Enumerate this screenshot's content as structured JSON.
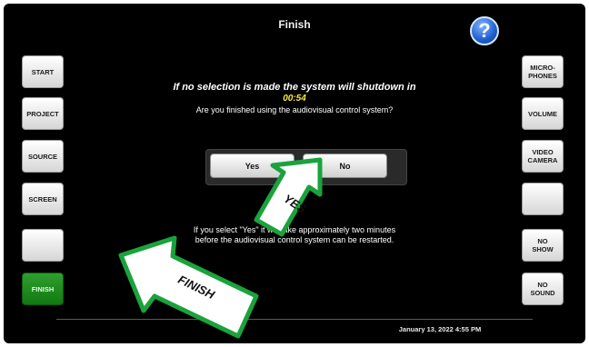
{
  "title": "Finish",
  "help_icon": "?",
  "left_buttons": [
    {
      "label": "START"
    },
    {
      "label": "PROJECT"
    },
    {
      "label": "SOURCE"
    },
    {
      "label": "SCREEN"
    },
    {
      "label": ""
    },
    {
      "label": "FINISH"
    }
  ],
  "right_buttons": [
    {
      "label": "MICRO-\nPHONES"
    },
    {
      "label": "VOLUME"
    },
    {
      "label": "VIDEO\nCAMERA"
    },
    {
      "label": ""
    },
    {
      "label": "NO\nSHOW"
    },
    {
      "label": "NO\nSOUND"
    }
  ],
  "message": {
    "warning": "If no selection is made the system will shutdown in",
    "countdown": "00:54",
    "question": "Are you finished using the audiovisual control system?",
    "note_line1": "If you select \"Yes\" it will take approximately two minutes",
    "note_line2": "before the audiovisual control system can be restarted."
  },
  "dialog": {
    "yes_label": "Yes",
    "no_label": "No"
  },
  "annotations": {
    "yes_arrow_label": "YES",
    "finish_arrow_label": "FINISH"
  },
  "datetime": "January 13, 2022 4:55 PM",
  "colors": {
    "accent_green": "#1a8a1a",
    "arrow_green": "#1aa33c",
    "countdown_yellow": "#f5e63a"
  }
}
